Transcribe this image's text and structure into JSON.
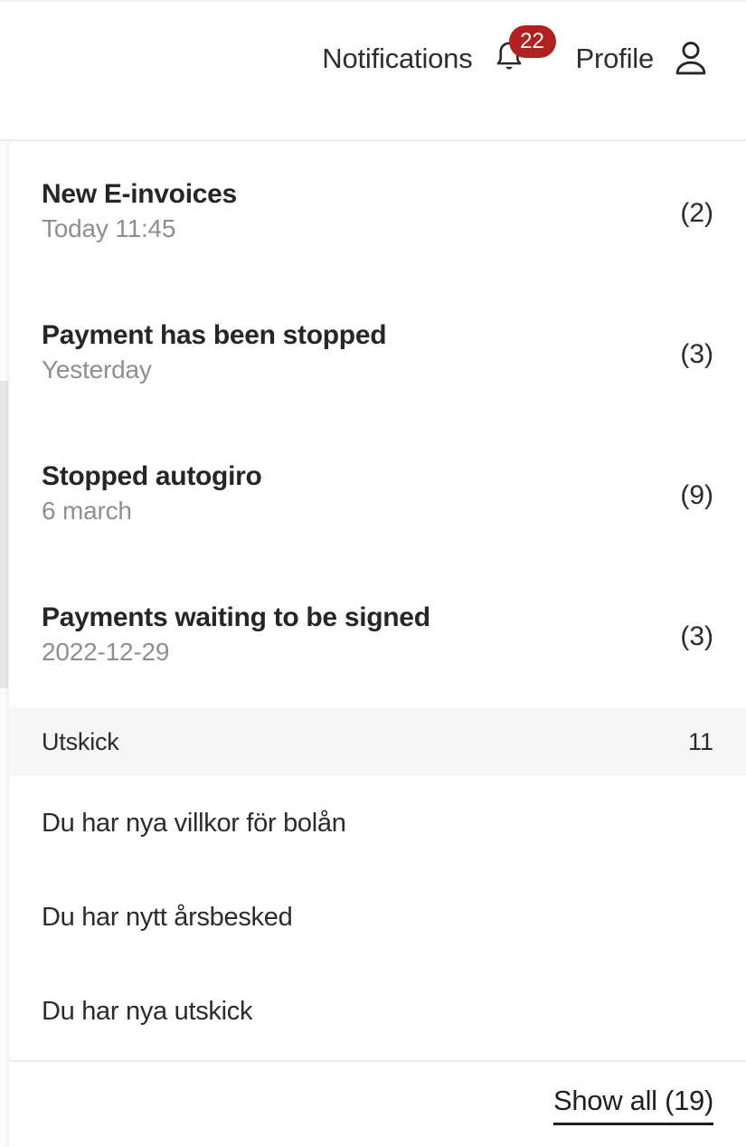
{
  "header": {
    "notifications_label": "Notifications",
    "bell_icon": "bell-icon",
    "badge_count": "22",
    "profile_label": "Profile",
    "profile_icon": "person-icon",
    "badge_color": "#b0221f"
  },
  "panel": {
    "notifications": [
      {
        "title": "New E-invoices",
        "time": "Today 11:45",
        "count": "(2)"
      },
      {
        "title": "Payment has been stopped",
        "time": "Yesterday",
        "count": "(3)"
      },
      {
        "title": "Stopped autogiro",
        "time": "6 march",
        "count": "(9)"
      },
      {
        "title": "Payments waiting to be signed",
        "time": "2022-12-29",
        "count": "(3)"
      }
    ],
    "section": {
      "label": "Utskick",
      "count": "11",
      "background": "#f6f6f6"
    },
    "sub_items": [
      {
        "label": "Du har nya villkor för bolån"
      },
      {
        "label": "Du har nytt årsbesked"
      },
      {
        "label": "Du har nya utskick"
      }
    ],
    "footer": {
      "show_all_label": "Show all (19)"
    }
  }
}
